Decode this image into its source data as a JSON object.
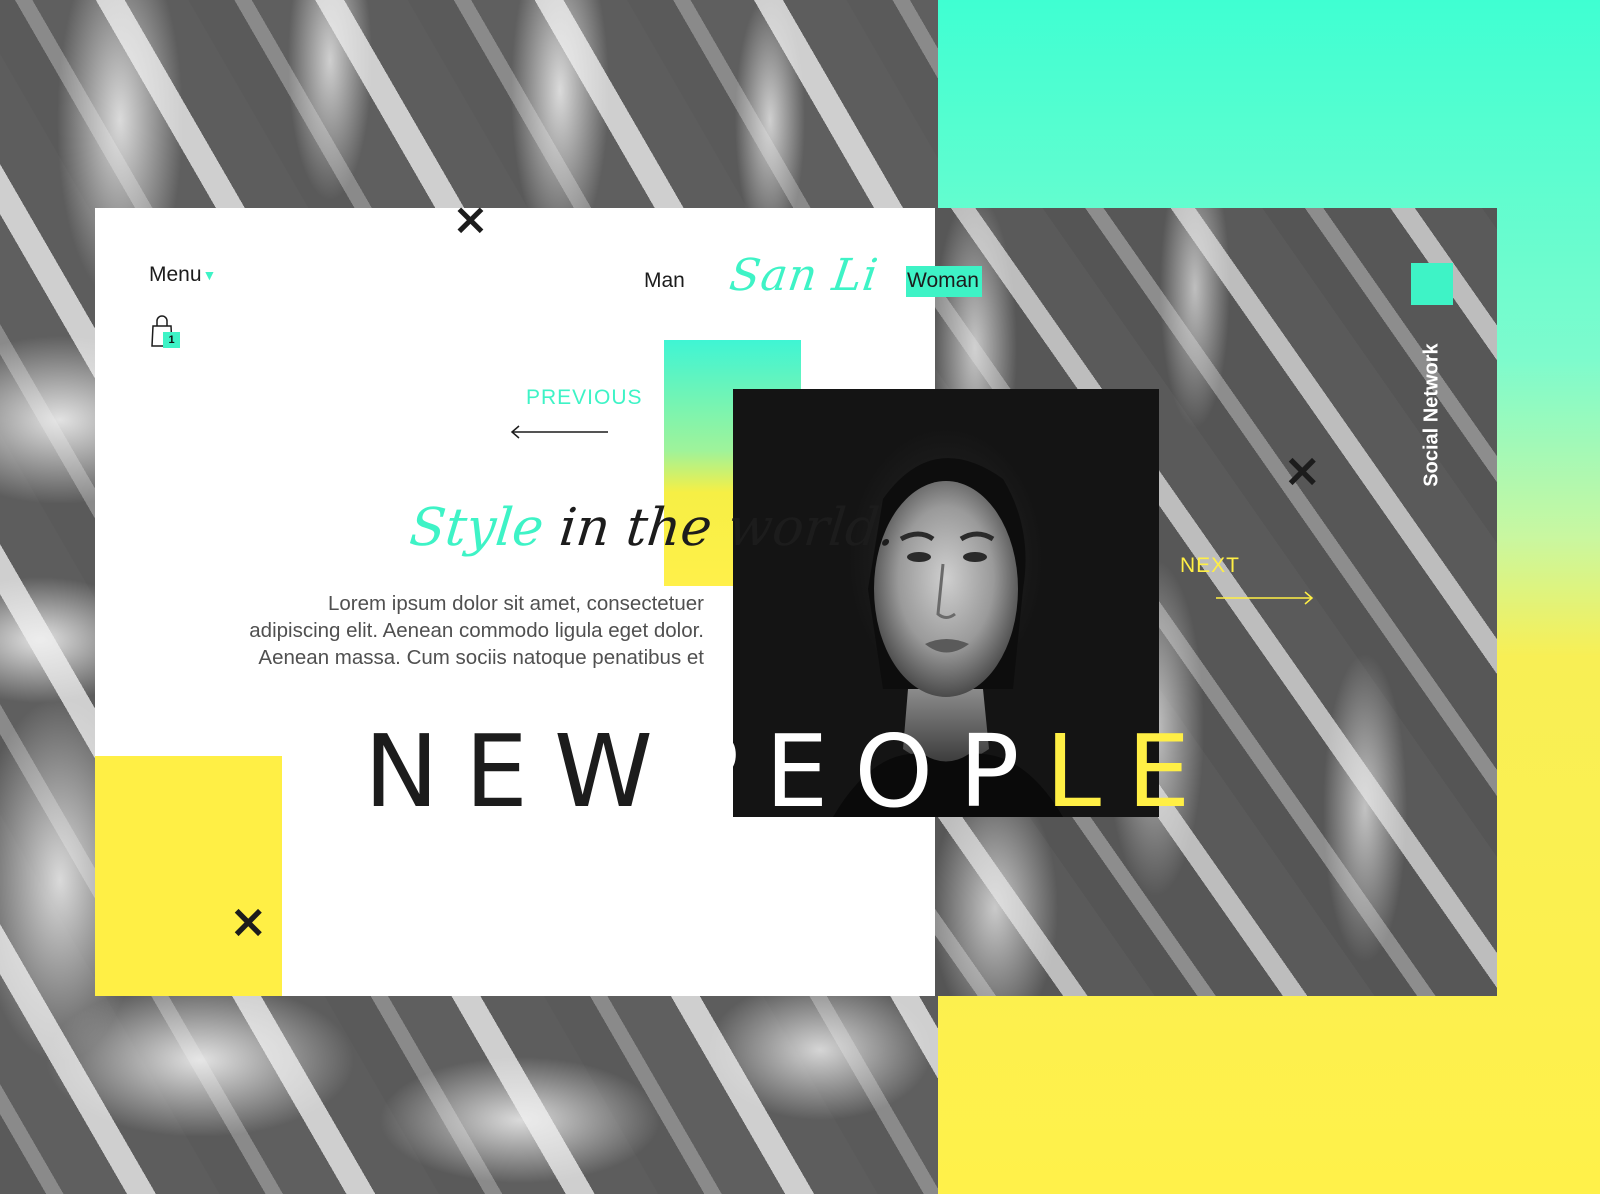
{
  "nav": {
    "menu_label": "Menu",
    "menu_caret": "▼",
    "cart_count": "1",
    "man_label": "Man",
    "brand": "San Li",
    "woman_label": "Woman"
  },
  "slider": {
    "previous_label": "PREVIOUS",
    "next_label": "NEXT"
  },
  "hero": {
    "tagline_part1": "Style",
    "tagline_part2": " in the world.",
    "body_text": "Lorem ipsum dolor sit amet, consectetuer adipiscing elit. Aenean commodo ligula eget dolor. Aenean massa. Cum sociis natoque penatibus et",
    "headline_part1": "NEW",
    "headline_part2": "PEOP",
    "headline_part3": "LE"
  },
  "side": {
    "social_label": "Social Network"
  },
  "icons": {
    "close": "×",
    "cart": "shopping-bag-icon"
  },
  "colors": {
    "accent_teal": "#3ef3c6",
    "accent_yellow": "#ffef45",
    "dark": "#1c1c1c"
  }
}
